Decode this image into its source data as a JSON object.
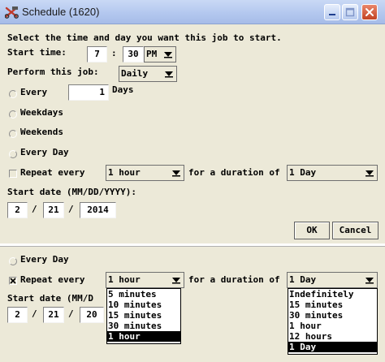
{
  "window": {
    "title": "Schedule (1620)",
    "instruction": "Select the time and day you want this job to start."
  },
  "start_time": {
    "label": "Start time:",
    "hour": "7",
    "separator": ":",
    "minute": "30",
    "ampm": "PM"
  },
  "perform": {
    "label": "Perform this job:",
    "value": "Daily"
  },
  "options": {
    "every_label": "Every",
    "every_value": "1",
    "days_label": "Days",
    "weekdays_label": "Weekdays",
    "weekends_label": "Weekends",
    "every_day_label": "Every Day"
  },
  "repeat": {
    "label": "Repeat every",
    "interval": "1 hour",
    "duration_label": "for a duration of",
    "duration": "1 Day"
  },
  "start_date": {
    "label": "Start date (MM/DD/YYYY):",
    "month": "2",
    "day": "21",
    "year": "2014",
    "separator": "/"
  },
  "buttons": {
    "ok": "OK",
    "cancel": "Cancel"
  },
  "panel2": {
    "every_day_label": "Every Day",
    "repeat_label": "Repeat every",
    "interval": "1 hour",
    "duration_label": "for a duration of",
    "duration": "1 Day",
    "start_date_label_partial": "Start date (MM/D",
    "month": "2",
    "day": "21",
    "year_partial": "20",
    "interval_options": [
      "5 minutes",
      "10 minutes",
      "15 minutes",
      "30 minutes",
      "1 hour"
    ],
    "interval_selected_index": 4,
    "duration_options": [
      "Indefinitely",
      "15 minutes",
      "30 minutes",
      "1 hour",
      "12 hours",
      "1 Day"
    ],
    "duration_selected_index": 5
  },
  "colors": {
    "dialog_bg": "#ece9d8",
    "titlebar": "#b4c8ef",
    "close_button": "#c24424",
    "selection": "#000000"
  },
  "icons": {
    "app": "scissors-x-icon",
    "minimize": "minimize-icon",
    "maximize": "maximize-icon",
    "close": "close-icon"
  }
}
